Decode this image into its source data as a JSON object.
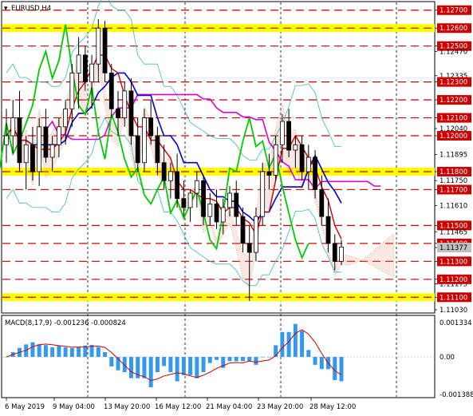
{
  "title": "EURUSD,H4",
  "indicator_label": "MACD(8,17,9) -0.001236 -0.000824",
  "colors": {
    "background": "#ffffff",
    "resistance_line": "#cc0000",
    "highlight_band": "#ffff00",
    "price_label_bg": "#cc0000",
    "current_price_bg": "#c0c0c0",
    "candle": "#000000",
    "chikou": "#00cc00",
    "kijun": "#0000cc",
    "tenkan": "#cc0000",
    "senkou_b": "#dd00dd",
    "cloud": "#e08060",
    "bollinger": "#33bbbb",
    "macd_hist": "#3399ee",
    "macd_signal": "#cc0000"
  },
  "price_axis": [
    {
      "value": "1.12700",
      "boxed": true
    },
    {
      "value": "1.12600",
      "boxed": true
    },
    {
      "value": "1.12500",
      "boxed": true
    },
    {
      "value": "1.12470",
      "boxed": false
    },
    {
      "value": "1.12335",
      "boxed": false
    },
    {
      "value": "1.12300",
      "boxed": true
    },
    {
      "value": "1.12200",
      "boxed": true
    },
    {
      "value": "1.12100",
      "boxed": true
    },
    {
      "value": "1.12040",
      "boxed": false
    },
    {
      "value": "1.12000",
      "boxed": true
    },
    {
      "value": "1.11895",
      "boxed": false
    },
    {
      "value": "1.11800",
      "boxed": true
    },
    {
      "value": "1.11750",
      "boxed": false
    },
    {
      "value": "1.11700",
      "boxed": true
    },
    {
      "value": "1.11610",
      "boxed": false
    },
    {
      "value": "1.11500",
      "boxed": true
    },
    {
      "value": "1.11465",
      "boxed": false
    },
    {
      "value": "1.11400",
      "boxed": true
    },
    {
      "value": "1.11377",
      "boxed": false,
      "current": true
    },
    {
      "value": "1.11300",
      "boxed": true
    },
    {
      "value": "1.11175",
      "boxed": false
    },
    {
      "value": "1.11200",
      "boxed": true
    },
    {
      "value": "1.11100",
      "boxed": true
    },
    {
      "value": "1.11030",
      "boxed": false
    }
  ],
  "resistance_levels": [
    "1.12700",
    "1.12600",
    "1.12500",
    "1.12300",
    "1.12200",
    "1.12100",
    "1.12000",
    "1.11800",
    "1.11700",
    "1.11500",
    "1.11400",
    "1.11300",
    "1.11200",
    "1.11100"
  ],
  "highlighted_levels": [
    "1.12600",
    "1.11800",
    "1.11100"
  ],
  "macd_axis": [
    "0.001334",
    "0.00",
    "-0.001388"
  ],
  "time_axis": [
    "6 May 2019",
    "9 May 04:00",
    "13 May 20:00",
    "16 May 12:00",
    "21 May 04:00",
    "23 May 20:00",
    "28 May 12:00"
  ],
  "chart_data": {
    "type": "candlestick",
    "symbol": "EURUSD",
    "timeframe": "H4",
    "ylim": [
      1.1103,
      1.1273
    ],
    "current_price": 1.11377,
    "candles": [
      [
        1.1195,
        1.1215,
        1.1185,
        1.12
      ],
      [
        1.12,
        1.122,
        1.119,
        1.121
      ],
      [
        1.121,
        1.1225,
        1.118,
        1.1185
      ],
      [
        1.1185,
        1.12,
        1.117,
        1.1195
      ],
      [
        1.1195,
        1.1205,
        1.1175,
        1.118
      ],
      [
        1.118,
        1.121,
        1.1172,
        1.1205
      ],
      [
        1.1205,
        1.1215,
        1.1185,
        1.1188
      ],
      [
        1.1188,
        1.12,
        1.118,
        1.1195
      ],
      [
        1.1195,
        1.121,
        1.1188,
        1.1205
      ],
      [
        1.1205,
        1.122,
        1.1195,
        1.1215
      ],
      [
        1.1215,
        1.124,
        1.1205,
        1.1235
      ],
      [
        1.1235,
        1.1255,
        1.1215,
        1.1245
      ],
      [
        1.1245,
        1.125,
        1.1225,
        1.123
      ],
      [
        1.123,
        1.1245,
        1.1215,
        1.124
      ],
      [
        1.124,
        1.1265,
        1.123,
        1.126
      ],
      [
        1.126,
        1.1264,
        1.123,
        1.1235
      ],
      [
        1.1235,
        1.124,
        1.121,
        1.1215
      ],
      [
        1.1215,
        1.1225,
        1.12,
        1.121
      ],
      [
        1.121,
        1.123,
        1.1205,
        1.1225
      ],
      [
        1.1225,
        1.1232,
        1.1195,
        1.12
      ],
      [
        1.12,
        1.121,
        1.118,
        1.1185
      ],
      [
        1.1185,
        1.1215,
        1.118,
        1.121
      ],
      [
        1.121,
        1.122,
        1.1195,
        1.12
      ],
      [
        1.12,
        1.1205,
        1.1178,
        1.1185
      ],
      [
        1.1185,
        1.1195,
        1.117,
        1.1175
      ],
      [
        1.1175,
        1.1185,
        1.1165,
        1.118
      ],
      [
        1.118,
        1.119,
        1.116,
        1.1165
      ],
      [
        1.1165,
        1.1175,
        1.1155,
        1.116
      ],
      [
        1.116,
        1.117,
        1.1152,
        1.1168
      ],
      [
        1.1168,
        1.118,
        1.116,
        1.1175
      ],
      [
        1.1175,
        1.1178,
        1.115,
        1.1155
      ],
      [
        1.1155,
        1.1168,
        1.115,
        1.1162
      ],
      [
        1.1162,
        1.117,
        1.1148,
        1.1152
      ],
      [
        1.1152,
        1.1165,
        1.1145,
        1.116
      ],
      [
        1.116,
        1.1172,
        1.1155,
        1.1168
      ],
      [
        1.1168,
        1.1175,
        1.115,
        1.1155
      ],
      [
        1.1155,
        1.116,
        1.1135,
        1.114
      ],
      [
        1.114,
        1.115,
        1.1108,
        1.1135
      ],
      [
        1.1135,
        1.116,
        1.113,
        1.1155
      ],
      [
        1.1155,
        1.1185,
        1.115,
        1.118
      ],
      [
        1.118,
        1.119,
        1.117,
        1.1178
      ],
      [
        1.1178,
        1.12,
        1.1175,
        1.1195
      ],
      [
        1.1195,
        1.1212,
        1.1185,
        1.1208
      ],
      [
        1.1208,
        1.1215,
        1.1188,
        1.1192
      ],
      [
        1.1192,
        1.12,
        1.1182,
        1.1195
      ],
      [
        1.1195,
        1.12,
        1.1175,
        1.118
      ],
      [
        1.118,
        1.1195,
        1.117,
        1.1188
      ],
      [
        1.1188,
        1.1192,
        1.1165,
        1.117
      ],
      [
        1.117,
        1.1178,
        1.115,
        1.1155
      ],
      [
        1.1155,
        1.1165,
        1.1135,
        1.114
      ],
      [
        1.114,
        1.1145,
        1.1125,
        1.113
      ],
      [
        1.113,
        1.1142,
        1.1128,
        1.1138
      ]
    ]
  }
}
